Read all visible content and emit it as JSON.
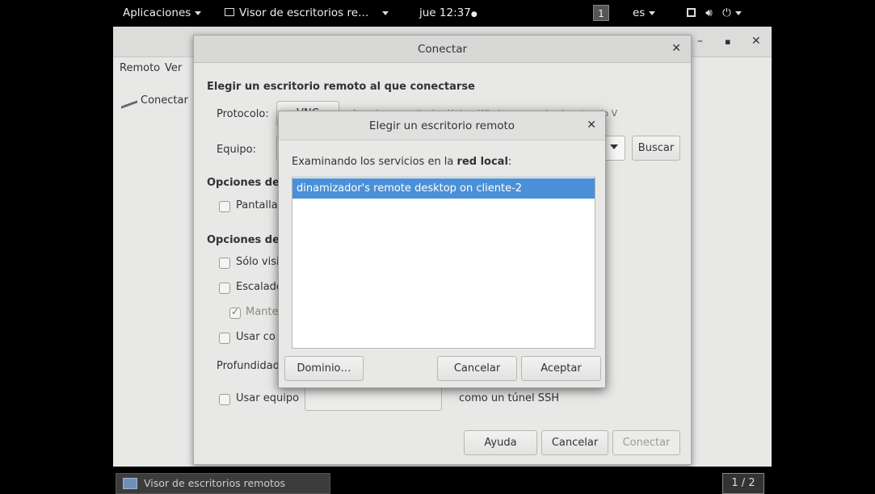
{
  "topbar": {
    "apps": "Aplicaciones",
    "window": "Visor de escritorios re…",
    "clock": "jue 12:37",
    "clock_dot": "●",
    "workspace": "1",
    "lang": "es"
  },
  "main": {
    "menu": [
      "Remoto",
      "Ver"
    ],
    "toolbar_connect": "Conectar"
  },
  "connect": {
    "title": "Conectar",
    "heading": "Elegir un escritorio remoto al que conectarse",
    "protocol_label": "Protocolo:",
    "protocol_value": "VNC",
    "protocol_hint": "Acceder a escritorios Unix y Windows usando el protocolo VNC - remoto.",
    "host_label": "Equipo:",
    "search": "Buscar",
    "conn_options": "Opciones de",
    "fullscreen": "Pantalla",
    "vnc_options": "Opciones de",
    "view_only": "Sólo visi",
    "scaling": "Escalado",
    "keep_aspect": "Mante",
    "use_jpeg": "Usar co",
    "depth": "Profundidad",
    "ssh_use": "Usar equipo",
    "ssh_tunnel": "como un túnel SSH",
    "help": "Ayuda",
    "cancel": "Cancelar",
    "connect": "Conectar"
  },
  "picker": {
    "title": "Elegir un escritorio remoto",
    "prompt_before": "Examinando los servicios en la ",
    "prompt_bold": "red local",
    "prompt_after": ":",
    "items": [
      "dinamizador's remote desktop on cliente-2"
    ],
    "domain": "Dominio…",
    "cancel": "Cancelar",
    "accept": "Aceptar"
  },
  "taskbar": {
    "item": "Visor de escritorios remotos",
    "pager": "1 / 2"
  }
}
